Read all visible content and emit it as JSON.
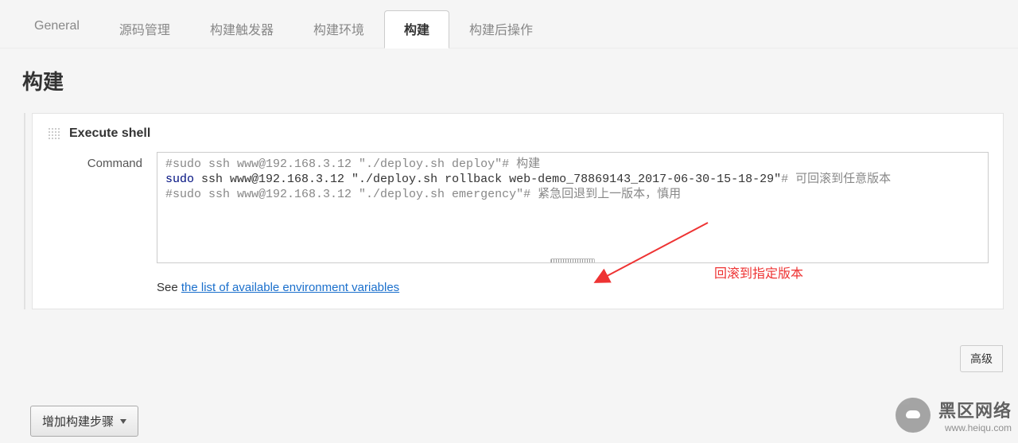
{
  "tabs": [
    {
      "label": "General",
      "active": false
    },
    {
      "label": "源码管理",
      "active": false
    },
    {
      "label": "构建触发器",
      "active": false
    },
    {
      "label": "构建环境",
      "active": false
    },
    {
      "label": "构建",
      "active": true
    },
    {
      "label": "构建后操作",
      "active": false
    }
  ],
  "section_title": "构建",
  "step": {
    "title": "Execute shell",
    "command_label": "Command",
    "lines": [
      {
        "text": "#sudo ssh www@192.168.3.12 \"./deploy.sh deploy\"",
        "type": "comment",
        "tail": "# 构建"
      },
      {
        "prefix": "sudo",
        "rest": " ssh www@192.168.3.12 \"./deploy.sh rollback web-demo_78869143_2017-06-30-15-18-29\"",
        "tail": "# 可回滚到任意版本",
        "type": "active"
      },
      {
        "text": "#sudo ssh www@192.168.3.12 \"./deploy.sh emergency\"",
        "type": "comment",
        "tail": "# 紧急回退到上一版本，慎用"
      }
    ],
    "see_prefix": "See ",
    "see_link": "the list of available environment variables",
    "advanced_label": "高级"
  },
  "add_step_label": "增加构建步骤",
  "annotation_text": "回滚到指定版本",
  "watermark": {
    "title": "黑区网络",
    "url": "www.heiqu.com"
  }
}
